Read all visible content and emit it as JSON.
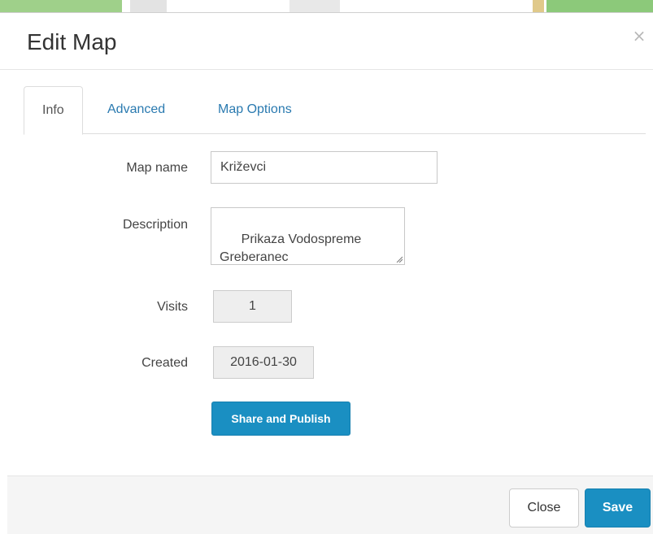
{
  "modal": {
    "title": "Edit Map",
    "close_icon": "close-icon",
    "close_glyph": "×"
  },
  "tabs": [
    {
      "label": "Info",
      "active": true
    },
    {
      "label": "Advanced",
      "active": false
    },
    {
      "label": "Map Options",
      "active": false
    }
  ],
  "form": {
    "map_name": {
      "label": "Map name",
      "value": "Križevci"
    },
    "description": {
      "label": "Description",
      "value": "Prikaza Vodospreme\nGreberanec"
    },
    "visits": {
      "label": "Visits",
      "value": "1"
    },
    "created": {
      "label": "Created",
      "value": "2016-01-30"
    },
    "share_label": "Share and Publish"
  },
  "footer": {
    "close_label": "Close",
    "save_label": "Save"
  },
  "colors": {
    "accent": "#1a8fc2",
    "link": "#2a7ab0",
    "footer_bg": "#f5f5f5",
    "map_green": "#8cc97a"
  }
}
